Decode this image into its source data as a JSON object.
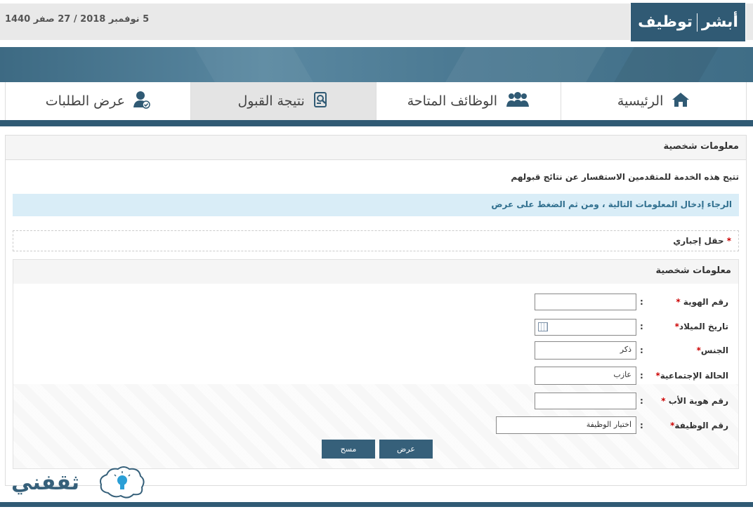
{
  "header": {
    "date": "5 نوفمبر 2018 / 27 صفر 1440",
    "logo_left": "أبشر",
    "logo_right": "توظيف"
  },
  "nav": {
    "items": [
      {
        "label": "الرئيسية",
        "icon": "home-icon"
      },
      {
        "label": "الوظائف المتاحة",
        "icon": "users-group-icon"
      },
      {
        "label": "نتيجة القبول",
        "icon": "search-document-icon"
      },
      {
        "label": "عرض الطلبات",
        "icon": "user-check-icon"
      }
    ],
    "active": "نتيجة القبول"
  },
  "panel": {
    "title": "معلومات شخصية",
    "intro": "تتيح هذه الخدمة للمتقدمين الاستفسار عن نتائج قبولهم",
    "alert": "الرجاء إدخال المعلومات التالية ، ومن ثم الضغط على عرض",
    "required_note": "حقل إجباري",
    "required_star": "*"
  },
  "form": {
    "title": "معلومات شخصية",
    "colon": ":",
    "fields": [
      {
        "label": "رقم الهوية",
        "value": ""
      },
      {
        "label": "تاريخ الميلاد",
        "value": ""
      },
      {
        "label": "الجنس",
        "value": "ذكر"
      },
      {
        "label": "الحالة الإجتماعية",
        "value": "عازب"
      },
      {
        "label": "رقم هوية الأب",
        "value": ""
      },
      {
        "label": "رقم الوظيفة",
        "value": "اختيار الوظيفة"
      }
    ],
    "submit_label": "عرض",
    "clear_label": "مسح"
  },
  "watermark": {
    "brand": "ثقفني"
  },
  "colors": {
    "brand_dark": "#305a74",
    "button": "#36607a",
    "alert_bg": "#d9edf7",
    "alert_text": "#31708f",
    "required": "#cc0000"
  }
}
